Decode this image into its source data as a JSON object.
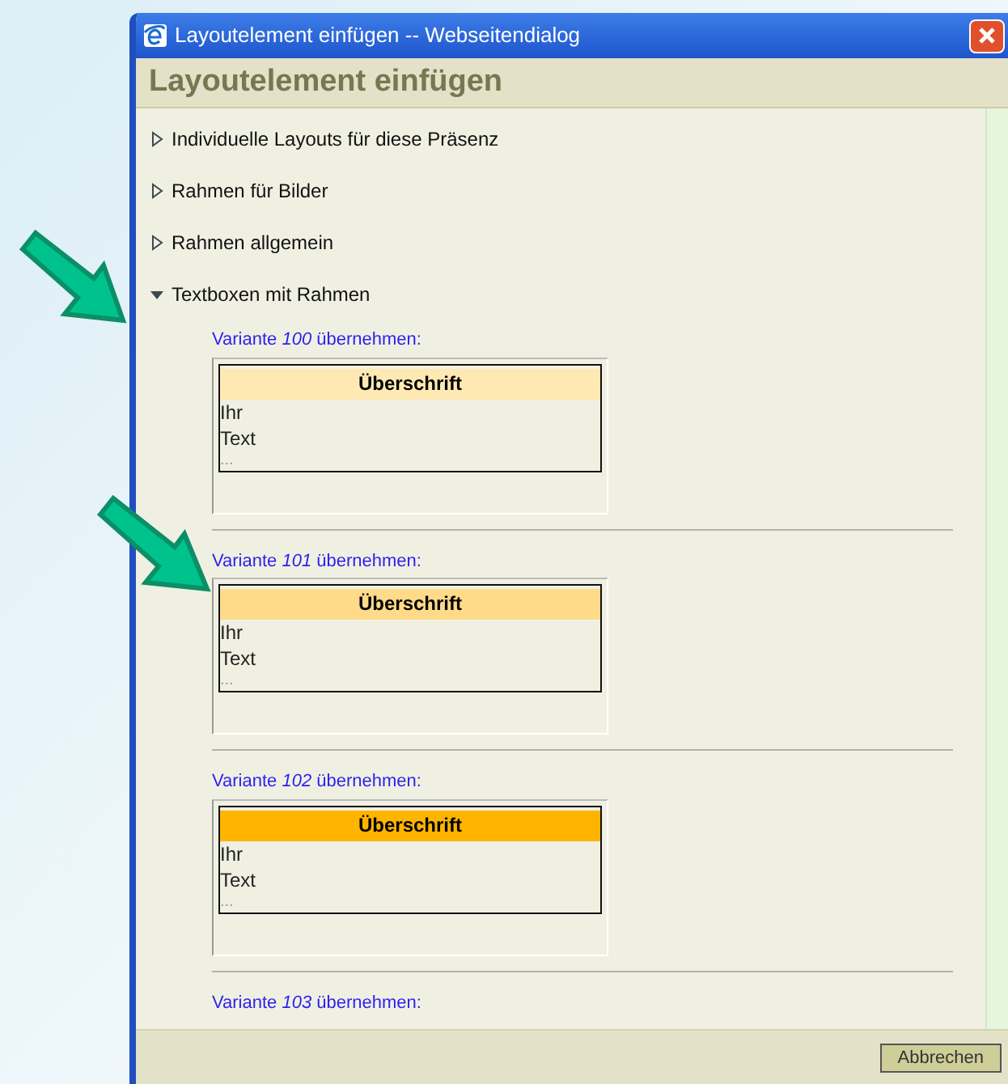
{
  "window": {
    "title": "Layoutelement einfügen -- Webseitendialog"
  },
  "heading": "Layoutelement einfügen",
  "tree": [
    {
      "label": "Individuelle Layouts für diese Präsenz",
      "expanded": false
    },
    {
      "label": "Rahmen für Bilder",
      "expanded": false
    },
    {
      "label": "Rahmen allgemein",
      "expanded": false
    },
    {
      "label": "Textboxen mit Rahmen",
      "expanded": true,
      "variants": [
        {
          "label": "Variante *100* übernehmen:",
          "preview": {
            "heading": "Überschrift",
            "lines": [
              "Ihr",
              "Text",
              "..."
            ]
          },
          "color": "#ffe9b3"
        },
        {
          "label": "Variante *101* übernehmen:",
          "preview": {
            "heading": "Überschrift",
            "lines": [
              "Ihr",
              "Text",
              "..."
            ]
          },
          "color": "#ffda88"
        },
        {
          "label": "Variante *102* übernehmen:",
          "preview": {
            "heading": "Überschrift",
            "lines": [
              "Ihr",
              "Text",
              "..."
            ]
          },
          "color": "#ffb400"
        },
        {
          "label": "Variante *103* übernehmen:"
        }
      ]
    }
  ],
  "buttons": [
    {
      "label": "Abbrechen"
    }
  ]
}
